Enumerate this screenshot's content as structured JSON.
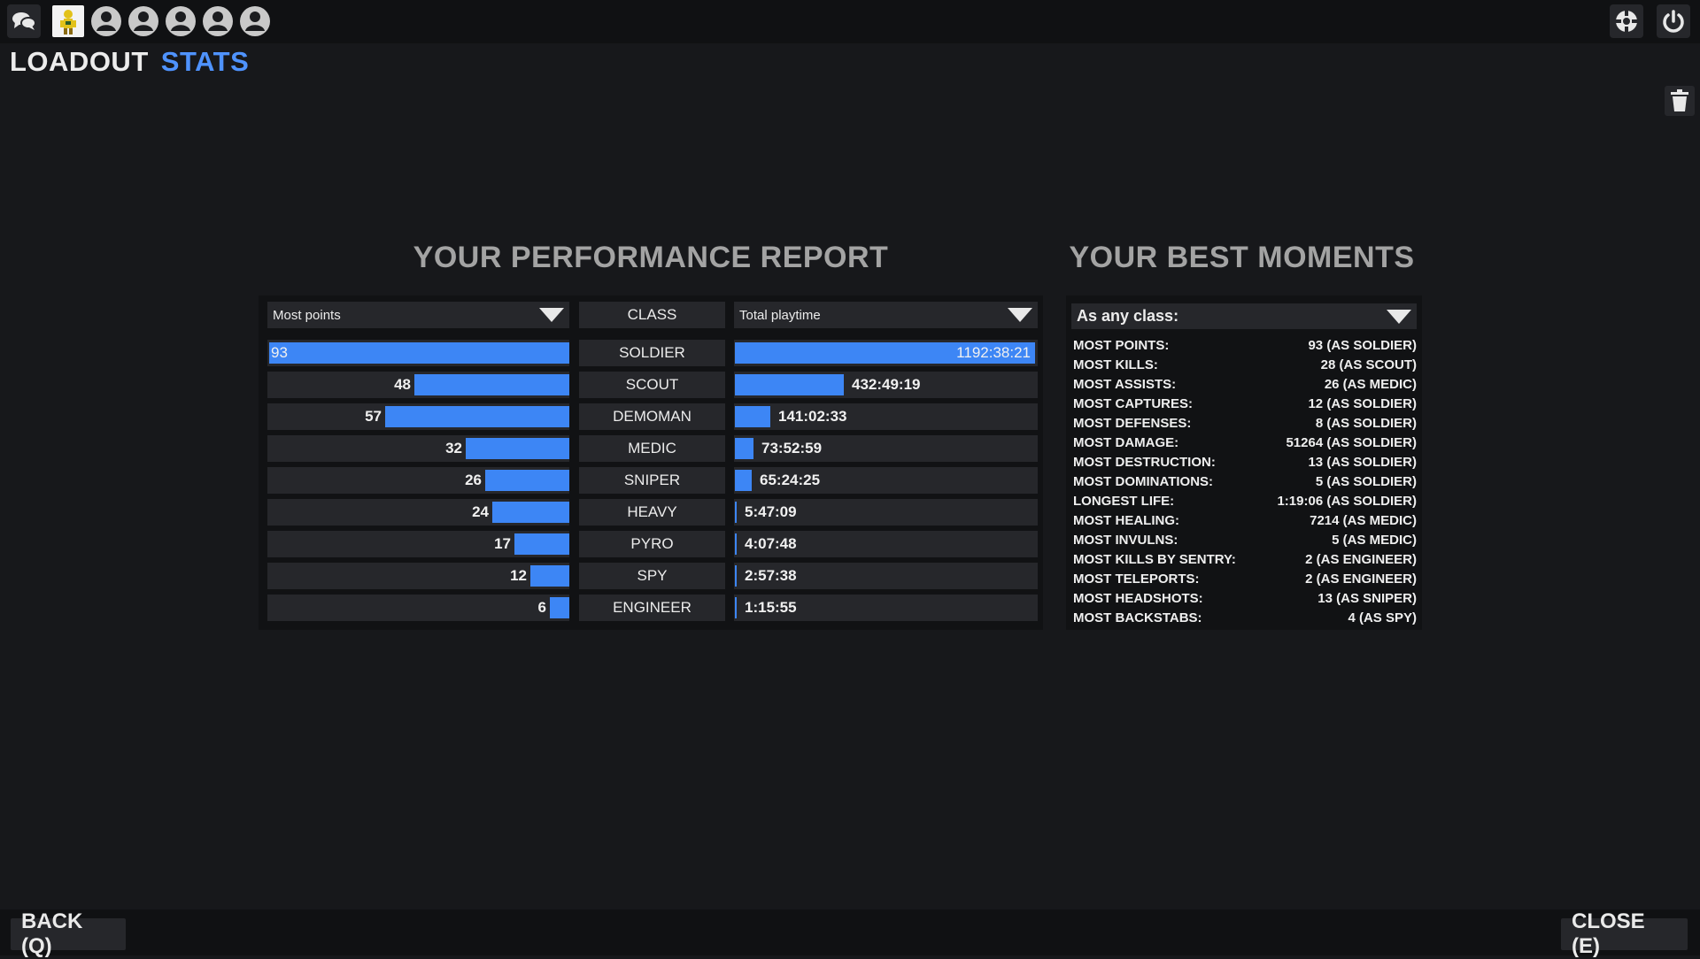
{
  "topbar": {
    "icons": [
      "chat-icon",
      "player-avatar",
      "friend-avatar-icon",
      "friend-avatar-icon",
      "friend-avatar-icon",
      "friend-avatar-icon",
      "friend-avatar-icon",
      "settings-icon",
      "power-icon"
    ]
  },
  "tabs": {
    "loadout": "LOADOUT",
    "stats": "STATS"
  },
  "performance": {
    "title": "YOUR PERFORMANCE REPORT",
    "left_dropdown": "Most points",
    "class_header": "CLASS",
    "right_dropdown": "Total playtime",
    "accent_color": "#3d86f5",
    "rows": [
      {
        "points": 93,
        "class": "SOLDIER",
        "playtime": "1192:38:21",
        "playtime_fraction": 1.0
      },
      {
        "points": 48,
        "class": "SCOUT",
        "playtime": "432:49:19",
        "playtime_fraction": 0.363
      },
      {
        "points": 57,
        "class": "DEMOMAN",
        "playtime": "141:02:33",
        "playtime_fraction": 0.118
      },
      {
        "points": 32,
        "class": "MEDIC",
        "playtime": "73:52:59",
        "playtime_fraction": 0.062
      },
      {
        "points": 26,
        "class": "SNIPER",
        "playtime": "65:24:25",
        "playtime_fraction": 0.055
      },
      {
        "points": 24,
        "class": "HEAVY",
        "playtime": "5:47:09",
        "playtime_fraction": 0.005
      },
      {
        "points": 17,
        "class": "PYRO",
        "playtime": "4:07:48",
        "playtime_fraction": 0.0035
      },
      {
        "points": 12,
        "class": "SPY",
        "playtime": "2:57:38",
        "playtime_fraction": 0.0025
      },
      {
        "points": 6,
        "class": "ENGINEER",
        "playtime": "1:15:55",
        "playtime_fraction": 0.001
      }
    ]
  },
  "moments": {
    "title": "YOUR BEST MOMENTS",
    "dropdown": "As any class:",
    "items": [
      {
        "label": "MOST POINTS:",
        "value": "93 (AS SOLDIER)"
      },
      {
        "label": "MOST KILLS:",
        "value": "28 (AS SCOUT)"
      },
      {
        "label": "MOST ASSISTS:",
        "value": "26 (AS MEDIC)"
      },
      {
        "label": "MOST CAPTURES:",
        "value": "12 (AS SOLDIER)"
      },
      {
        "label": "MOST DEFENSES:",
        "value": "8 (AS SOLDIER)"
      },
      {
        "label": "MOST DAMAGE:",
        "value": "51264 (AS SOLDIER)"
      },
      {
        "label": "MOST DESTRUCTION:",
        "value": "13 (AS SOLDIER)"
      },
      {
        "label": "MOST DOMINATIONS:",
        "value": "5 (AS SOLDIER)"
      },
      {
        "label": "LONGEST LIFE:",
        "value": "1:19:06 (AS SOLDIER)"
      },
      {
        "label": "MOST HEALING:",
        "value": "7214 (AS MEDIC)"
      },
      {
        "label": "MOST INVULNS:",
        "value": "5 (AS MEDIC)"
      },
      {
        "label": "MOST KILLS BY SENTRY:",
        "value": "2 (AS ENGINEER)"
      },
      {
        "label": "MOST TELEPORTS:",
        "value": "2 (AS ENGINEER)"
      },
      {
        "label": "MOST HEADSHOTS:",
        "value": "13 (AS SNIPER)"
      },
      {
        "label": "MOST BACKSTABS:",
        "value": "4 (AS SPY)"
      }
    ]
  },
  "footer": {
    "back": "BACK (Q)",
    "close": "CLOSE (E)"
  }
}
